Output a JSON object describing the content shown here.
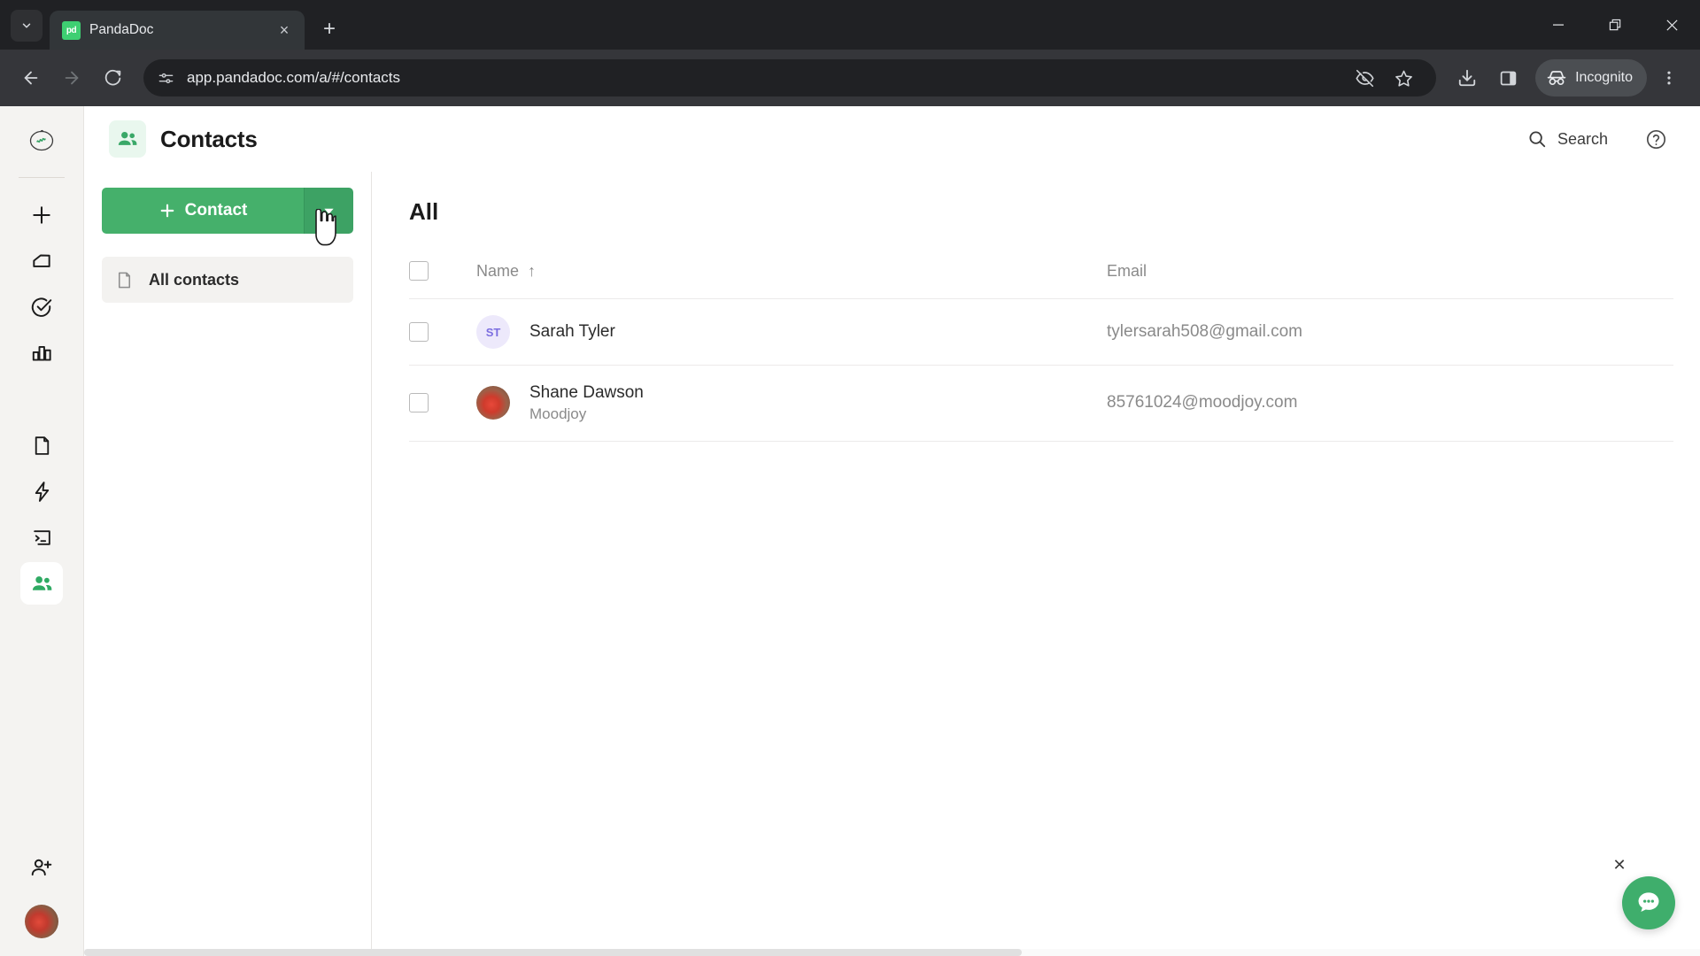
{
  "browser": {
    "tab": {
      "title": "PandaDoc",
      "favicon_text": "pd",
      "favicon_color": "#3ecf72"
    },
    "tab_list_icon": "chevron-down-icon",
    "new_tab_label": "+",
    "close_tab_label": "×",
    "window_controls": {
      "minimize": "—",
      "restore": "❐",
      "close": "✕"
    },
    "nav": {
      "back": "back-arrow-icon",
      "forward": "forward-arrow-icon",
      "reload": "reload-icon"
    },
    "omnibox": {
      "url": "app.pandadoc.com/a/#/contacts",
      "site_info_icon": "site-settings-icon"
    },
    "actions": {
      "tracking_protection": "eye-off-icon",
      "bookmark": "star-icon",
      "downloads": "download-icon",
      "side_panel": "side-panel-icon",
      "incognito_label": "Incognito",
      "menu": "three-dot-menu-icon"
    }
  },
  "rail": {
    "logo_label": "workspace-logo",
    "items": [
      {
        "name": "create-new",
        "icon": "plus-icon"
      },
      {
        "name": "home",
        "icon": "home-icon"
      },
      {
        "name": "tasks",
        "icon": "check-circle-icon"
      },
      {
        "name": "reports",
        "icon": "bar-chart-icon"
      },
      {
        "name": "documents",
        "icon": "document-icon"
      },
      {
        "name": "automation",
        "icon": "lightning-icon"
      },
      {
        "name": "templates",
        "icon": "template-icon"
      },
      {
        "name": "contacts",
        "icon": "people-icon",
        "active": true
      }
    ],
    "invite": {
      "name": "invite-user",
      "icon": "person-add-icon"
    },
    "avatar": "user-avatar"
  },
  "header": {
    "icon": "people-icon",
    "title": "Contacts",
    "search_label": "Search",
    "search_icon": "search-icon",
    "help_icon": "help-circle-icon"
  },
  "subnav": {
    "primary_button": {
      "label": "Contact",
      "plus_icon": "plus-icon",
      "caret_icon": "caret-down-icon"
    },
    "items": [
      {
        "label": "All contacts",
        "icon": "document-icon",
        "active": true
      }
    ]
  },
  "main": {
    "title": "All",
    "columns": {
      "name": "Name",
      "sort_icon": "↑",
      "email": "Email"
    },
    "select_all_checkbox": "unchecked",
    "rows": [
      {
        "checkbox": "unchecked",
        "avatar_type": "initials",
        "initials": "ST",
        "name": "Sarah Tyler",
        "company": "",
        "email": "tylersarah508@gmail.com"
      },
      {
        "checkbox": "unchecked",
        "avatar_type": "photo",
        "initials": "",
        "name": "Shane Dawson",
        "company": "Moodjoy",
        "email": "85761024@moodjoy.com"
      }
    ]
  },
  "chat": {
    "icon": "chat-bubble-icon",
    "close_label": "✕"
  },
  "colors": {
    "brand_green": "#45b06b",
    "brand_green_dark": "#3da264",
    "accent_green": "#3aa868",
    "avatar_purple_bg": "#ede9fb",
    "avatar_purple_text": "#7c6ee0",
    "text_primary": "#1b1b1b",
    "text_muted": "#8a8a8a"
  }
}
